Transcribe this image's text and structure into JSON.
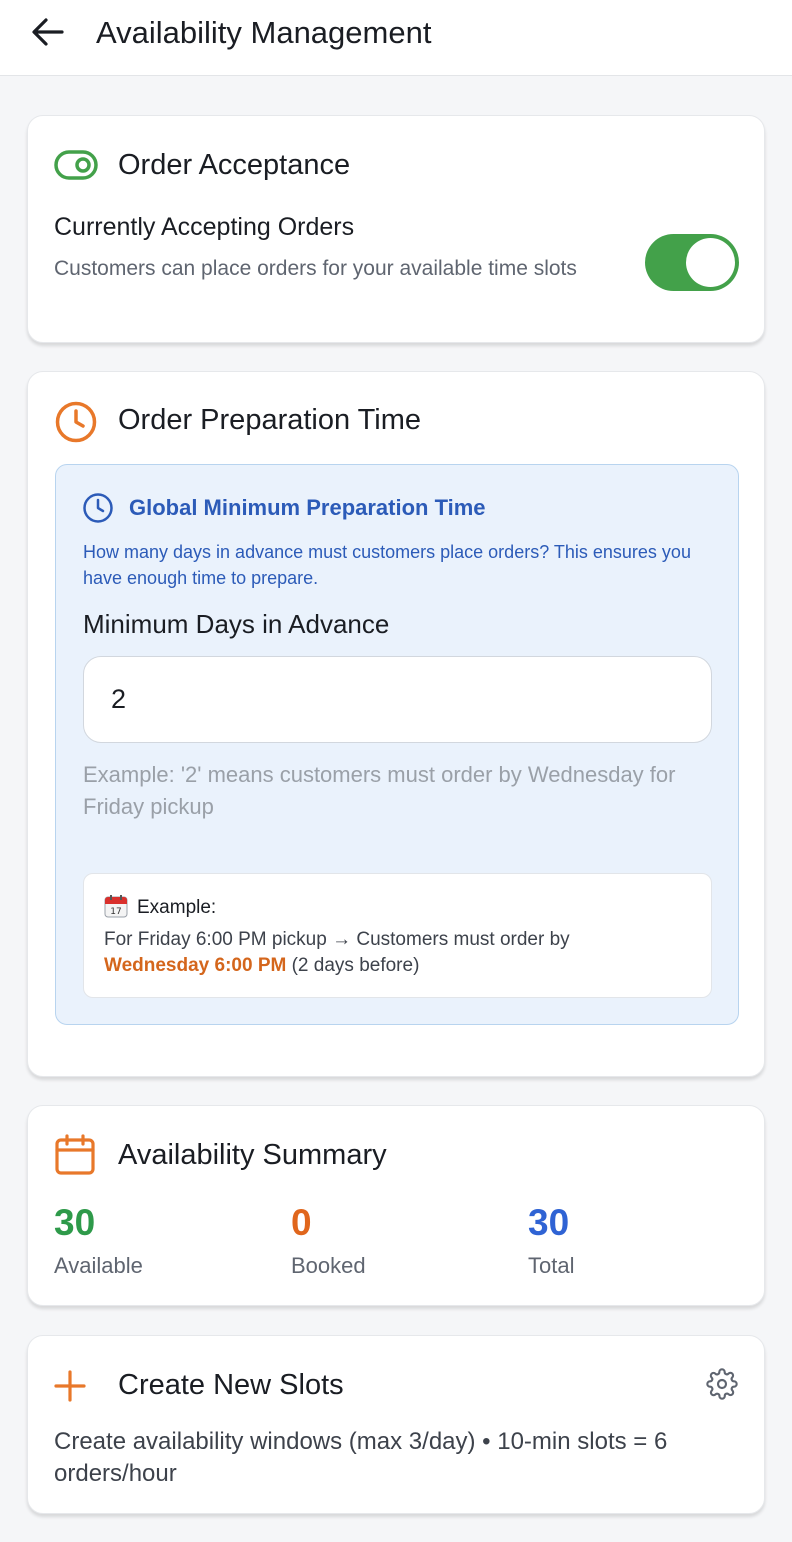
{
  "header": {
    "title": "Availability Management",
    "back_icon": "arrow-left-icon"
  },
  "order_acceptance": {
    "title": "Order Acceptance",
    "icon": "toggle-icon",
    "row_title": "Currently Accepting Orders",
    "row_description": "Customers can place orders for your available time slots",
    "toggle_on": true,
    "accent_color": "#43a14a"
  },
  "prep_time": {
    "title": "Order Preparation Time",
    "icon": "clock-icon",
    "accent_color": "#e8782a",
    "info": {
      "title": "Global Minimum Preparation Time",
      "description": "How many days in advance must customers place orders? This ensures you have enough time to prepare.",
      "color": "#2c5bb8"
    },
    "field_label": "Minimum Days in Advance",
    "field_value": "2",
    "hint": "Example: '2' means customers must order by Wednesday for Friday pickup",
    "example": {
      "label": "Example:",
      "text_before": "For Friday 6:00 PM pickup → Customers must order by",
      "highlight": "Wednesday 6:00 PM",
      "text_after": " (2 days before)"
    }
  },
  "summary": {
    "title": "Availability Summary",
    "icon": "calendar-icon",
    "stats": [
      {
        "value": "30",
        "label": "Available",
        "color": "#2e9a4a"
      },
      {
        "value": "0",
        "label": "Booked",
        "color": "#e0661c"
      },
      {
        "value": "30",
        "label": "Total",
        "color": "#2f63d4"
      }
    ]
  },
  "create": {
    "title": "Create New Slots",
    "icon": "plus-icon",
    "settings_icon": "gear-icon",
    "description": "Create availability windows (max 3/day) • 10-min slots = 6 orders/hour"
  }
}
